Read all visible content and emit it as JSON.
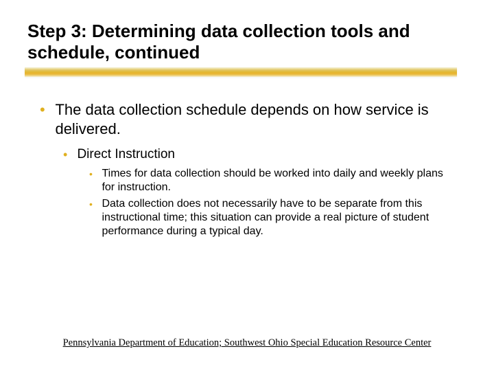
{
  "title": "Step 3:  Determining data collection tools and schedule, continued",
  "bullets": {
    "l1": "The data collection schedule depends on how service is delivered.",
    "l2": "Direct Instruction",
    "l3a": "Times for data collection should be worked into daily and weekly plans for instruction.",
    "l3b": "Data collection does not necessarily have to be separate from this instructional time; this situation can provide a real picture of student performance during a typical day."
  },
  "footer": "Pennsylvania Department of Education; Southwest Ohio Special Education Resource Center"
}
